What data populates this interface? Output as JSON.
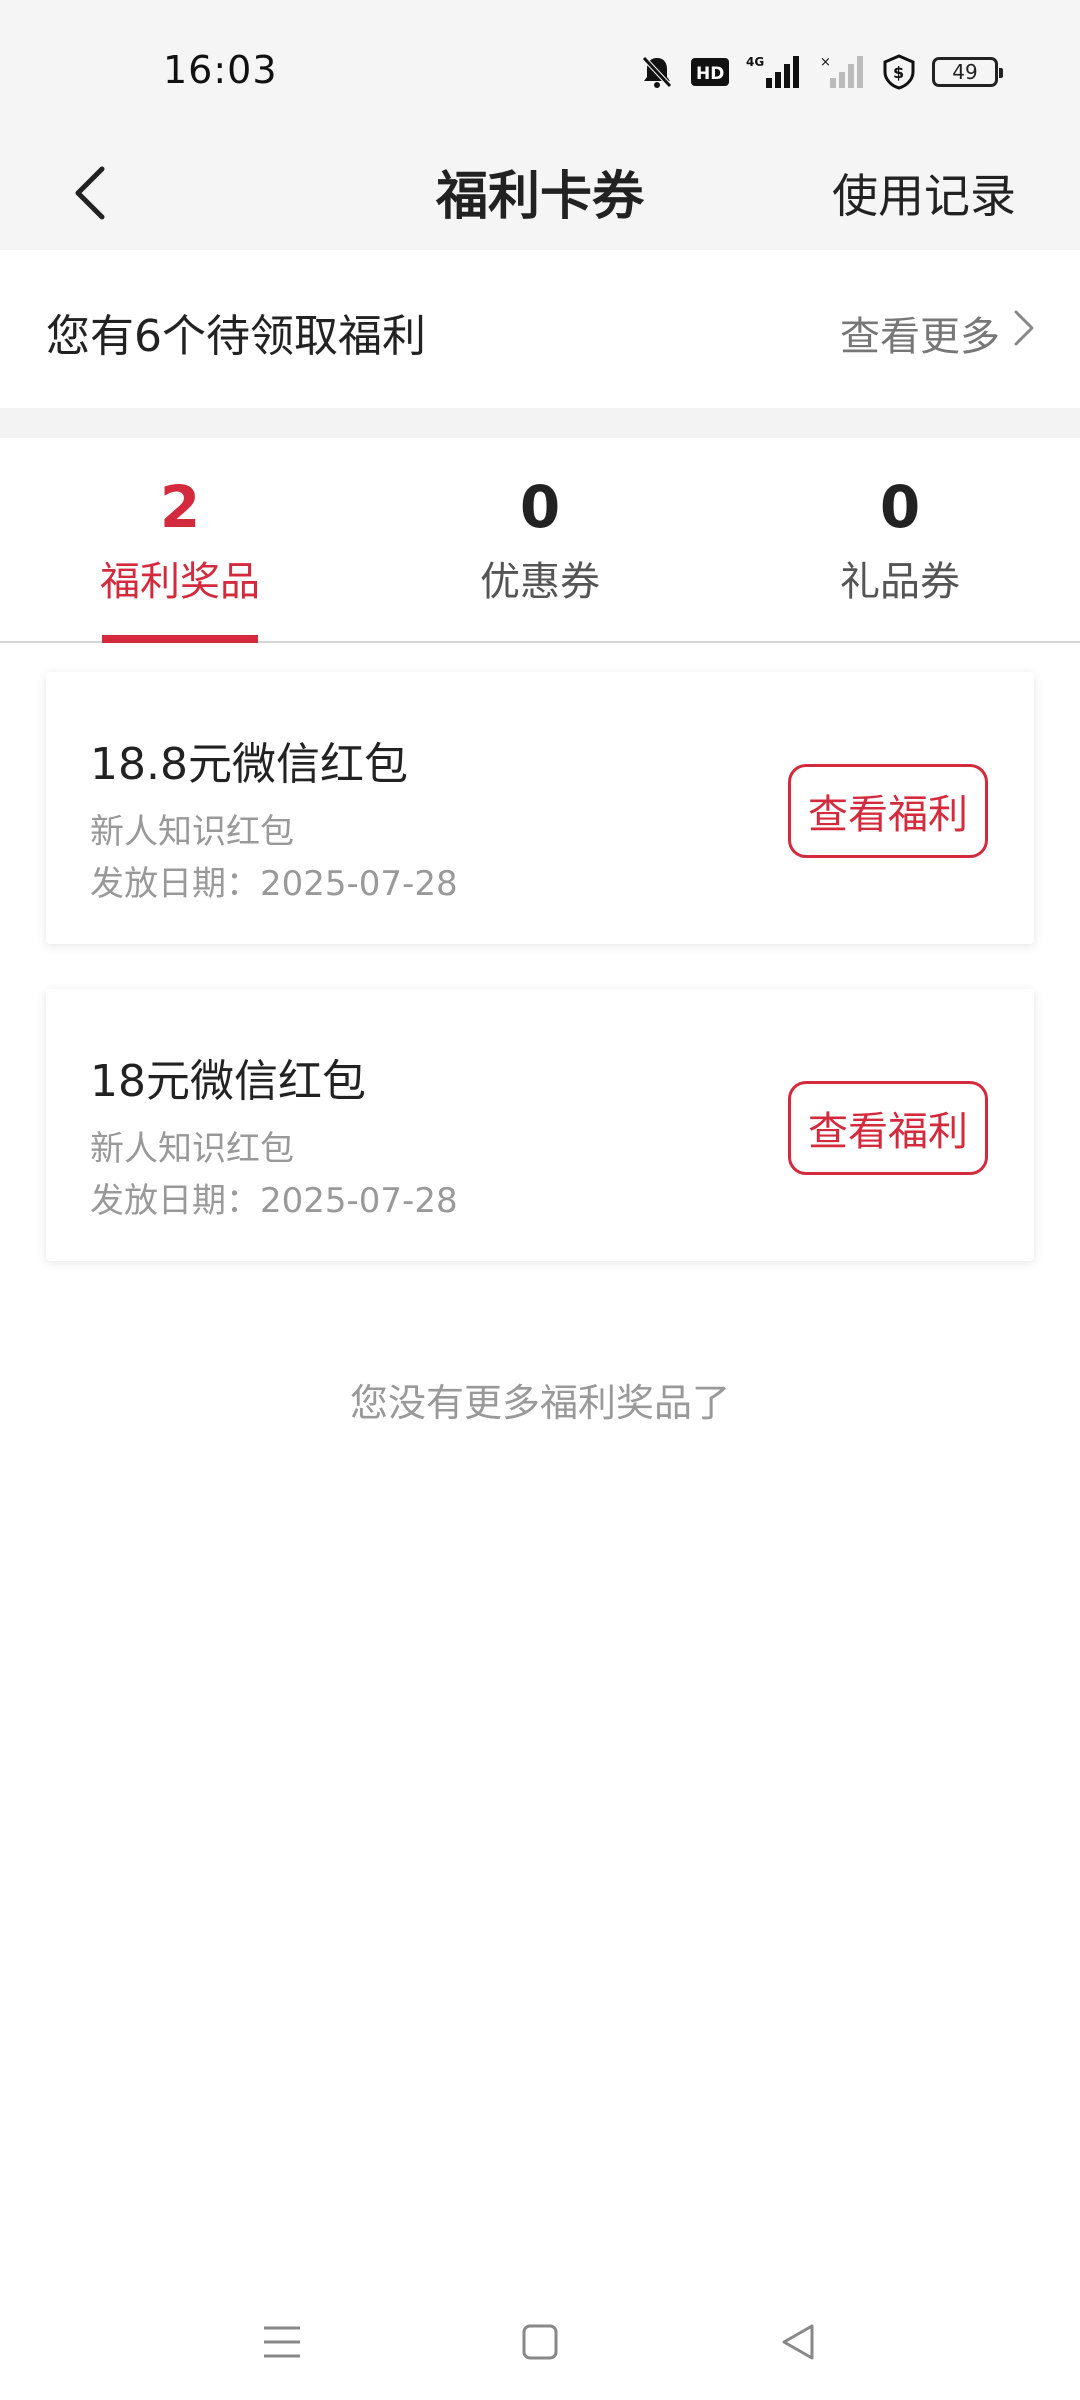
{
  "status_bar": {
    "time": "16:03",
    "battery": "49",
    "icons": [
      "bell-muted-icon",
      "hd-icon",
      "signal-4g-icon",
      "signal-no-service-icon",
      "shield-dollar-icon",
      "battery-icon"
    ]
  },
  "nav": {
    "title": "福利卡券",
    "action": "使用记录",
    "back_icon": "chevron-left-icon"
  },
  "pending": {
    "text": "您有6个待领取福利",
    "more": "查看更多",
    "more_icon": "chevron-right-icon"
  },
  "tabs": [
    {
      "count": "2",
      "label": "福利奖品",
      "active": true
    },
    {
      "count": "0",
      "label": "优惠券",
      "active": false
    },
    {
      "count": "0",
      "label": "礼品券",
      "active": false
    }
  ],
  "cards": [
    {
      "title": "18.8元微信红包",
      "subtitle": "新人知识红包",
      "date": "发放日期：2025-07-28",
      "button": "查看福利"
    },
    {
      "title": "18元微信红包",
      "subtitle": "新人知识红包",
      "date": "发放日期：2025-07-28",
      "button": "查看福利"
    }
  ],
  "end_note": "您没有更多福利奖品了",
  "colors": {
    "accent": "#d42a3d",
    "header_bg": "#f5f5f5",
    "muted_text": "#999999"
  },
  "system_nav": {
    "icons": [
      "menu-icon",
      "home-square-icon",
      "back-triangle-icon"
    ]
  }
}
